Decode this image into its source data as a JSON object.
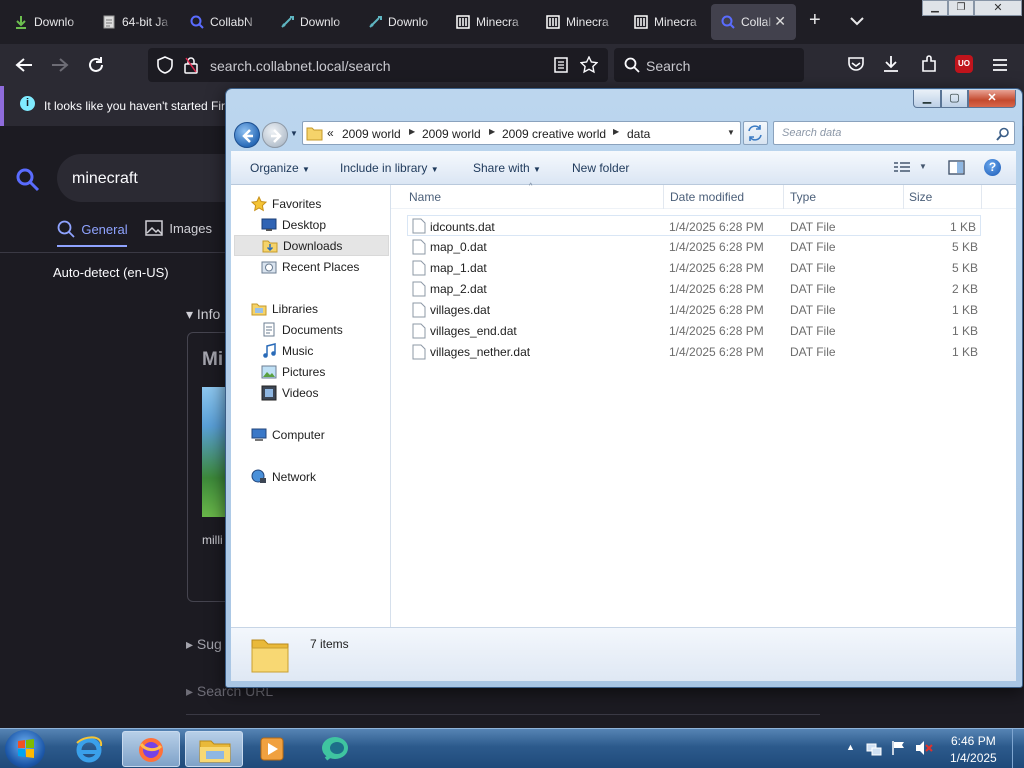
{
  "browser": {
    "tabs": [
      {
        "label": "Downlo",
        "icon": "download-arrow-icon"
      },
      {
        "label": "64-bit Ja",
        "icon": "document-icon"
      },
      {
        "label": "CollabN",
        "icon": "search-icon"
      },
      {
        "label": "Downlo",
        "icon": "sword-icon"
      },
      {
        "label": "Downlo",
        "icon": "sword-icon"
      },
      {
        "label": "Minecra",
        "icon": "museum-icon"
      },
      {
        "label": "Minecra",
        "icon": "museum-icon"
      },
      {
        "label": "Minecra",
        "icon": "museum-icon"
      },
      {
        "label": "Collal",
        "icon": "search-icon",
        "active": true
      }
    ],
    "url": "search.collabnet.local/search",
    "search_placeholder": "Search",
    "notification": "It looks like you haven't started Fir",
    "accent": "#8f6cdc"
  },
  "page": {
    "query": "minecraft",
    "tab_general": "General",
    "tab_images": "Images",
    "language": "Auto-detect (en-US)",
    "info_label": "Info",
    "card_title": "Mi",
    "card_text": "milli",
    "suggestions_label": "Sug",
    "search_url_label": "Search URL"
  },
  "explorer": {
    "breadcrumb": [
      "2009 world",
      "2009 world",
      "2009 creative world",
      "data"
    ],
    "breadcrumb_prefix": "«",
    "search_placeholder": "Search data",
    "toolbar": {
      "organize": "Organize",
      "include_in_library": "Include in library",
      "share_with": "Share with",
      "new_folder": "New folder"
    },
    "nav": {
      "favorites": "Favorites",
      "desktop": "Desktop",
      "downloads": "Downloads",
      "recent_places": "Recent Places",
      "libraries": "Libraries",
      "documents": "Documents",
      "music": "Music",
      "pictures": "Pictures",
      "videos": "Videos",
      "computer": "Computer",
      "network": "Network"
    },
    "columns": {
      "name": "Name",
      "date": "Date modified",
      "type": "Type",
      "size": "Size"
    },
    "files": [
      {
        "name": "idcounts.dat",
        "date": "1/4/2025 6:28 PM",
        "type": "DAT File",
        "size": "1 KB"
      },
      {
        "name": "map_0.dat",
        "date": "1/4/2025 6:28 PM",
        "type": "DAT File",
        "size": "5 KB"
      },
      {
        "name": "map_1.dat",
        "date": "1/4/2025 6:28 PM",
        "type": "DAT File",
        "size": "5 KB"
      },
      {
        "name": "map_2.dat",
        "date": "1/4/2025 6:28 PM",
        "type": "DAT File",
        "size": "2 KB"
      },
      {
        "name": "villages.dat",
        "date": "1/4/2025 6:28 PM",
        "type": "DAT File",
        "size": "1 KB"
      },
      {
        "name": "villages_end.dat",
        "date": "1/4/2025 6:28 PM",
        "type": "DAT File",
        "size": "1 KB"
      },
      {
        "name": "villages_nether.dat",
        "date": "1/4/2025 6:28 PM",
        "type": "DAT File",
        "size": "1 KB"
      }
    ],
    "item_count": "7 items"
  },
  "taskbar": {
    "time": "6:46 PM",
    "date": "1/4/2025"
  }
}
